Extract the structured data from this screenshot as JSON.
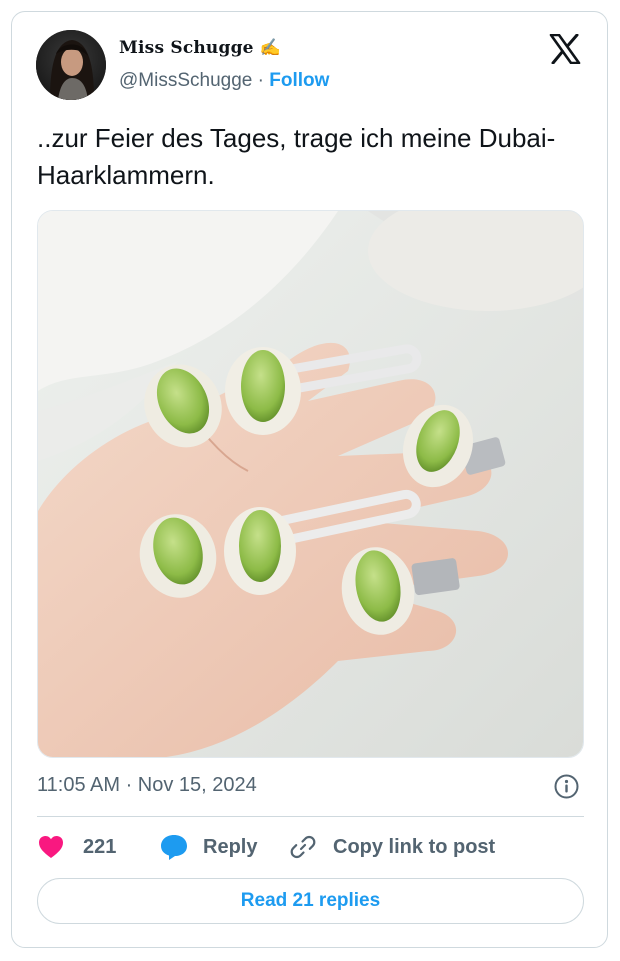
{
  "author": {
    "display_name": "Miss Schugge",
    "name_emoji": "✍",
    "handle": "@MissSchugge",
    "separator": "·",
    "follow_label": "Follow",
    "avatar_icon": "user-avatar"
  },
  "brand": {
    "logo_icon": "x-logo",
    "color": "#0f1419"
  },
  "tweet": {
    "text": "..zur Feier des Tages, trage ich meine Dubai-Haarklammern.",
    "photo_icon": "tweet-photo"
  },
  "meta": {
    "timestamp": "11:05 AM · Nov 15, 2024",
    "info_icon": "info-icon"
  },
  "actions": {
    "like_count": "221",
    "like_color": "#f91880",
    "reply_label": "Reply",
    "reply_color": "#1d9bf0",
    "copy_label": "Copy link to post"
  },
  "replies_button": {
    "label": "Read 21 replies"
  },
  "colors": {
    "accent": "#1d9bf0",
    "muted": "#536471",
    "border": "#cfd9de"
  }
}
